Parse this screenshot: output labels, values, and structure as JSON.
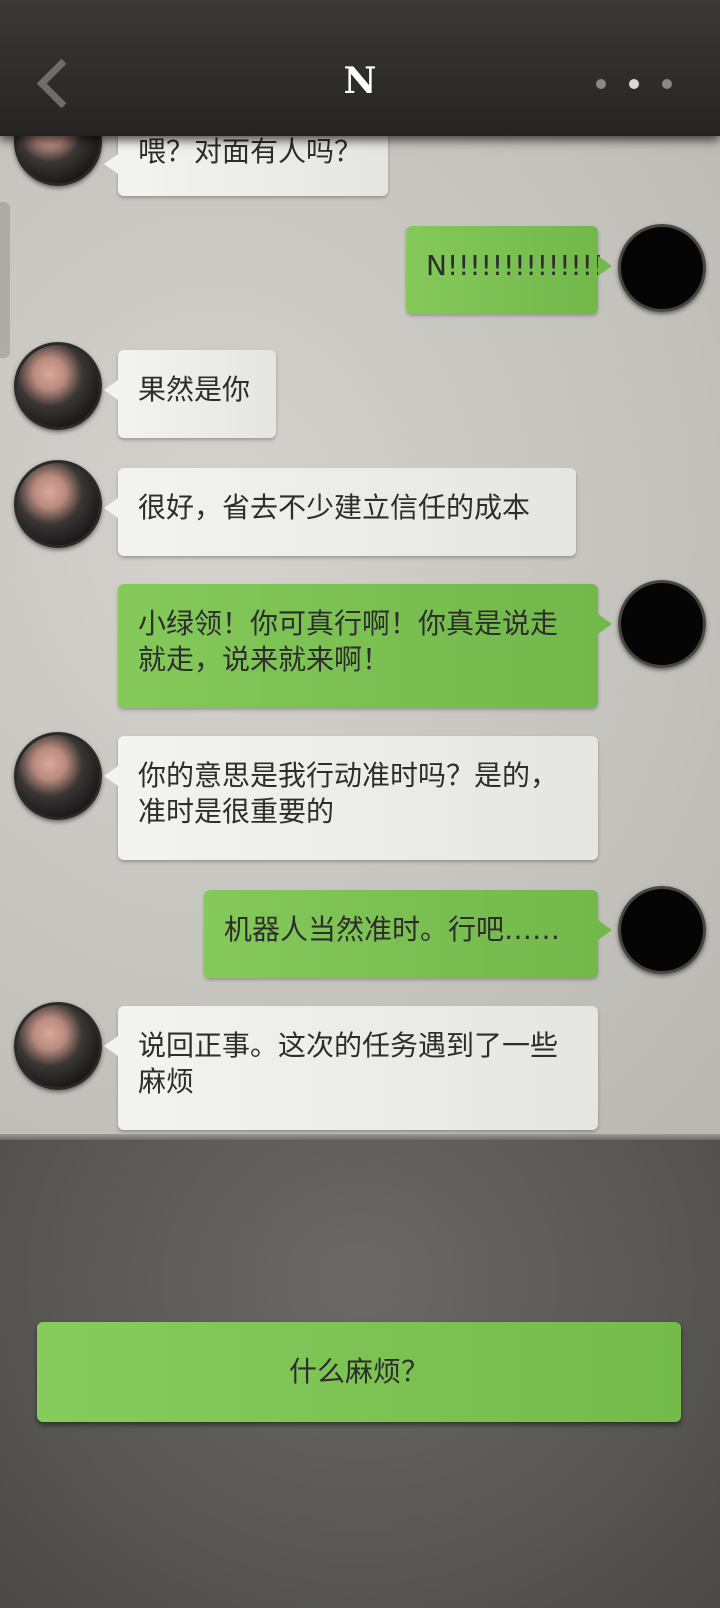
{
  "header": {
    "title": "N"
  },
  "messages": [
    {
      "sender": "other",
      "text": "喂？对面有人吗？"
    },
    {
      "sender": "self",
      "text": "N!!!!!!!!!!!!!!"
    },
    {
      "sender": "other",
      "text": "果然是你"
    },
    {
      "sender": "other",
      "text": "很好，省去不少建立信任的成本"
    },
    {
      "sender": "self",
      "text": "小绿领！你可真行啊！你真是说走就走，说来就来啊！"
    },
    {
      "sender": "other",
      "text": "你的意思是我行动准时吗？是的，准时是很重要的"
    },
    {
      "sender": "self",
      "text": "机器人当然准时。行吧……"
    },
    {
      "sender": "other",
      "text": "说回正事。这次的任务遇到了一些麻烦"
    }
  ],
  "reply_option": {
    "label": "什么麻烦？"
  },
  "colors": {
    "self_bubble": "#7cc253",
    "other_bubble": "#eeeeec",
    "header": "#2e2d2c"
  },
  "icons": {
    "back": "chevron-left-icon",
    "more": "more-dots-icon"
  }
}
